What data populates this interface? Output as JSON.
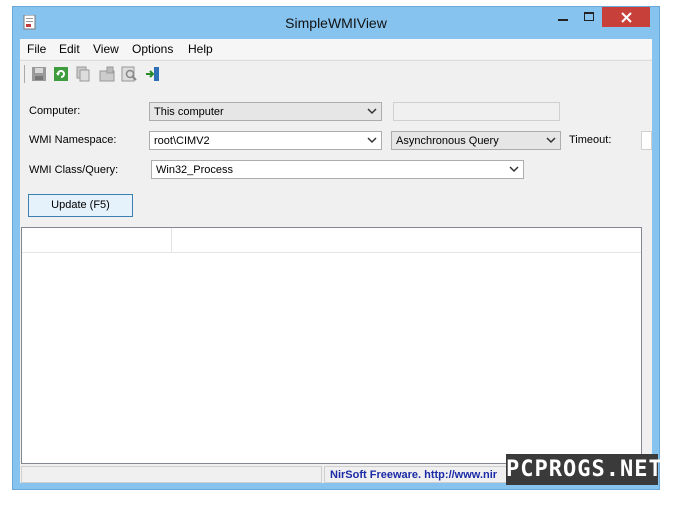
{
  "window": {
    "title": "SimpleWMIView",
    "accent": "#87c3ef",
    "close_color": "#c7413a"
  },
  "menu": {
    "items": [
      "File",
      "Edit",
      "View",
      "Options",
      "Help"
    ]
  },
  "toolbar": {
    "icons": [
      "save-icon",
      "refresh-icon",
      "copy-icon",
      "properties-icon",
      "find-icon",
      "exit-icon"
    ]
  },
  "form": {
    "computer_label": "Computer:",
    "computer_value": "This computer",
    "namespace_label": "WMI Namespace:",
    "namespace_value": "root\\CIMV2",
    "query_mode_value": "Asynchronous Query",
    "timeout_label": "Timeout:",
    "class_label": "WMI Class/Query:",
    "class_value": "Win32_Process",
    "update_button": "Update (F5)"
  },
  "statusbar": {
    "text": "NirSoft Freeware.  http://www.nir"
  },
  "watermark": {
    "text": "PCPROGS.NET"
  }
}
